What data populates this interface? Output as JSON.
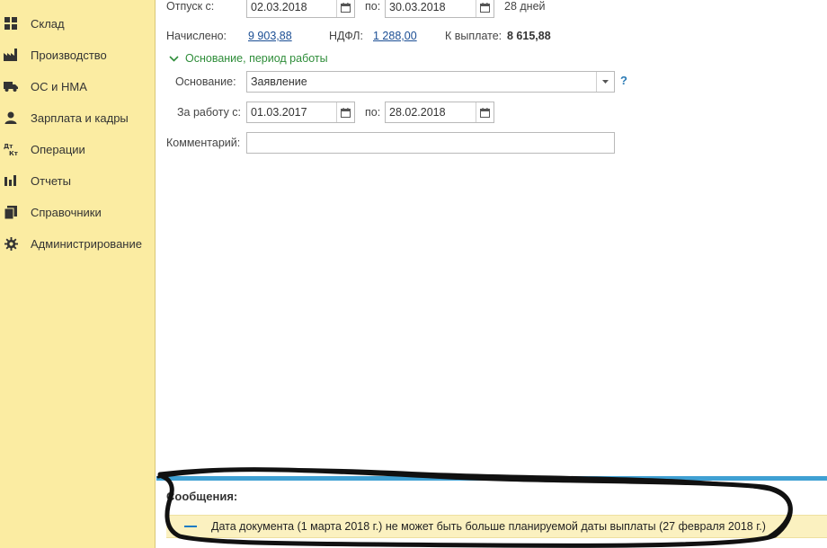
{
  "sidebar": {
    "items": [
      {
        "label": "Склад",
        "icon": "grid-icon"
      },
      {
        "label": "Производство",
        "icon": "factory-icon"
      },
      {
        "label": "ОС и НМА",
        "icon": "truck-icon"
      },
      {
        "label": "Зарплата и кадры",
        "icon": "person-icon"
      },
      {
        "label": "Операции",
        "icon": "debit-credit-icon"
      },
      {
        "label": "Отчеты",
        "icon": "bar-chart-icon"
      },
      {
        "label": "Справочники",
        "icon": "books-icon"
      },
      {
        "label": "Администрирование",
        "icon": "gear-icon"
      }
    ]
  },
  "vacation": {
    "label": "Отпуск с:",
    "from": "02.03.2018",
    "to_label": "по:",
    "to": "30.03.2018",
    "days": "28 дней"
  },
  "amounts": {
    "accrued_label": "Начислено:",
    "accrued": "9 903,88",
    "tax_label": "НДФЛ:",
    "tax": "1 288,00",
    "payout_label": "К выплате:",
    "payout": "8 615,88"
  },
  "group": {
    "title": "Основание, период работы",
    "basis_label": "Основание:",
    "basis_value": "Заявление",
    "help": "?",
    "work_label": "За работу с:",
    "work_from": "01.03.2017",
    "work_to_label": "по:",
    "work_to": "28.02.2018"
  },
  "comment": {
    "label": "Комментарий:",
    "value": ""
  },
  "messages": {
    "title": "Сообщения:",
    "items": [
      {
        "text": "Дата документа (1 марта 2018 г.) не может быть больше планируемой даты выплаты (27 февраля 2018 г.)"
      }
    ]
  },
  "colors": {
    "sidebar_bg": "#fbeca2",
    "accent_blue": "#3fa0d3",
    "group_green": "#2e8d39",
    "link_blue": "#1b4e94",
    "message_bg": "#fbf1c0"
  }
}
